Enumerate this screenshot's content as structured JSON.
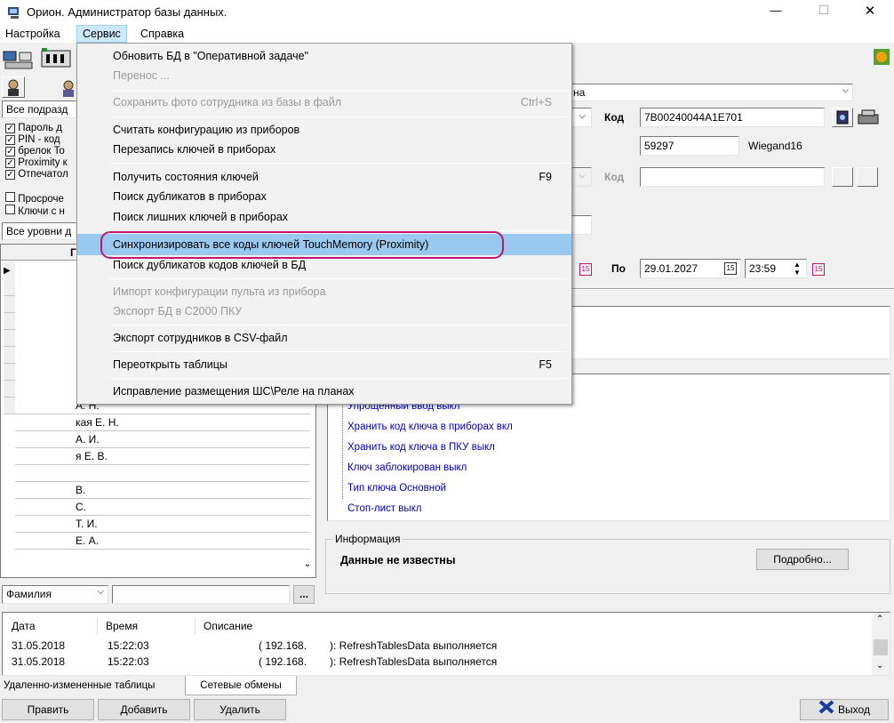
{
  "window": {
    "title": "Орион. Администратор базы данных.",
    "minimize": "—",
    "maximize": "☐",
    "close": "✕"
  },
  "menubar": {
    "items": [
      "Настройка",
      "Сервис",
      "Справка"
    ]
  },
  "service_menu": {
    "items": [
      {
        "label": "Обновить БД в \"Оперативной задаче\"",
        "shortcut": "",
        "enabled": true
      },
      {
        "label": "Перенос ...",
        "shortcut": "",
        "enabled": false
      },
      {
        "label": "Сохранить фото сотрудника из базы в файл",
        "shortcut": "Ctrl+S",
        "enabled": false
      },
      {
        "label": "Считать конфигурацию из приборов",
        "shortcut": "",
        "enabled": true
      },
      {
        "label": "Перезапись ключей в приборах",
        "shortcut": "",
        "enabled": true
      },
      {
        "label": "Получить состояния ключей",
        "shortcut": "F9",
        "enabled": true
      },
      {
        "label": "Поиск дубликатов в приборах",
        "shortcut": "",
        "enabled": true
      },
      {
        "label": "Поиск лишних ключей в приборах",
        "shortcut": "",
        "enabled": true
      },
      {
        "label": "Синхронизировать все коды ключей TouchMemory (Proximity)",
        "shortcut": "",
        "enabled": true
      },
      {
        "label": "Поиск дубликатов кодов ключей в БД",
        "shortcut": "",
        "enabled": true
      },
      {
        "label": "Импорт конфигурации пульта из прибора",
        "shortcut": "",
        "enabled": false
      },
      {
        "label": "Экспорт БД в С2000 ПКУ",
        "shortcut": "",
        "enabled": false
      },
      {
        "label": "Экспорт сотрудников в CSV-файл",
        "shortcut": "",
        "enabled": true
      },
      {
        "label": "Переоткрыть таблицы",
        "shortcut": "F5",
        "enabled": true
      },
      {
        "label": "Исправление размещения ШС\\Реле на планах",
        "shortcut": "",
        "enabled": true
      }
    ]
  },
  "left": {
    "dept_filter": "Все подразд",
    "key_types": [
      "Пароль д",
      "PIN - код",
      "брелок To",
      "Proximity к",
      "Отпечатол"
    ],
    "key_flags": [
      "Просроче",
      "Ключи с н"
    ],
    "levels_filter": "Все уровни д",
    "grid_header": "Г",
    "names": [
      "А. Н.",
      "кая Е. Н.",
      "А. И.",
      "я Е. В.",
      "",
      "В.",
      "С.",
      "Т. И.",
      "Е. А."
    ],
    "search_field_type": "Фамилия",
    "search_value": "",
    "browse_button": "..."
  },
  "right": {
    "combo_text": "на",
    "kod_label": "Код",
    "kod_value": "7B00240044A1E701",
    "number_value": "59297",
    "format_label": "Wiegand16",
    "kod2_label": "Код",
    "kod2_value": "",
    "po_label": "По",
    "date_value": "29.01.2027",
    "time_value": "23:59",
    "calendar_glyph": "15"
  },
  "attributes": [
    "Упрощенный ввод  выкл",
    "Хранить код ключа в приборах  вкл",
    "Хранить код ключа в ПКУ  выкл",
    "Ключ заблокирован  выкл",
    "Тип ключа  Основной",
    "Стоп-лист  выкл"
  ],
  "info": {
    "group_title": "Информация",
    "status": "Данные не известны",
    "details_button": "Подробно..."
  },
  "log": {
    "headers": [
      "Дата",
      "Время",
      "Описание"
    ],
    "rows": [
      {
        "date": "31.05.2018",
        "time": "15:22:03",
        "ip": "( 192.168.",
        "desc": "): RefreshTablesData выполняется"
      },
      {
        "date": "31.05.2018",
        "time": "15:22:03",
        "ip": "( 192.168.",
        "desc": "): RefreshTablesData выполняется"
      }
    ],
    "tabs": [
      "Удаленно-измененные таблицы",
      "Сетевые обмены"
    ]
  },
  "buttons": {
    "edit": "Править",
    "add": "Добавить",
    "delete": "Удалить",
    "exit": "Выход"
  },
  "colors": {
    "highlight": "#99c9ef",
    "annotation": "#c0186e",
    "link_blue": "#0000c8"
  }
}
